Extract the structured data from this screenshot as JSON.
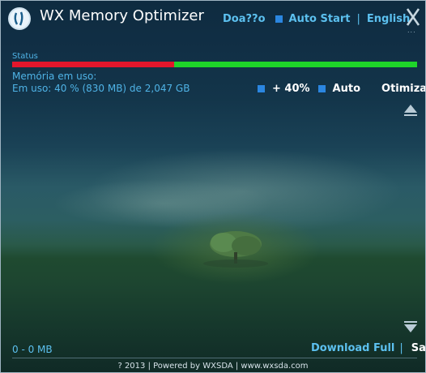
{
  "app": {
    "title": "WX Memory Optimizer",
    "logo_icon": "wx-logo-icon"
  },
  "topnav": {
    "donate_label": "Doa??o",
    "autostart_label": "Auto Start",
    "separator": "|",
    "language_label": "English",
    "close_icon": "close-x-icon",
    "more_label": "..."
  },
  "status": {
    "label": "Status",
    "used_fraction": 0.4,
    "used_color": "#e3162c",
    "free_color": "#1ed42a"
  },
  "memory": {
    "label": "Memória em uso:",
    "value": "Em uso: 40 % (830 MB) de 2,047 GB"
  },
  "options": {
    "threshold_label": "+ 40%",
    "auto_label": "Auto",
    "optimize_label": "Otimizar",
    "checkbox_color": "#2b86e0"
  },
  "scroll": {
    "up_icon": "scroll-up-icon",
    "down_icon": "scroll-down-icon"
  },
  "bottom": {
    "counter": "0 - 0 MB",
    "download_label": "Download Full",
    "separator": "|",
    "exit_label": "Sair"
  },
  "footer": {
    "text": "? 2013 | Powered by WXSDA | www.wxsda.com"
  }
}
